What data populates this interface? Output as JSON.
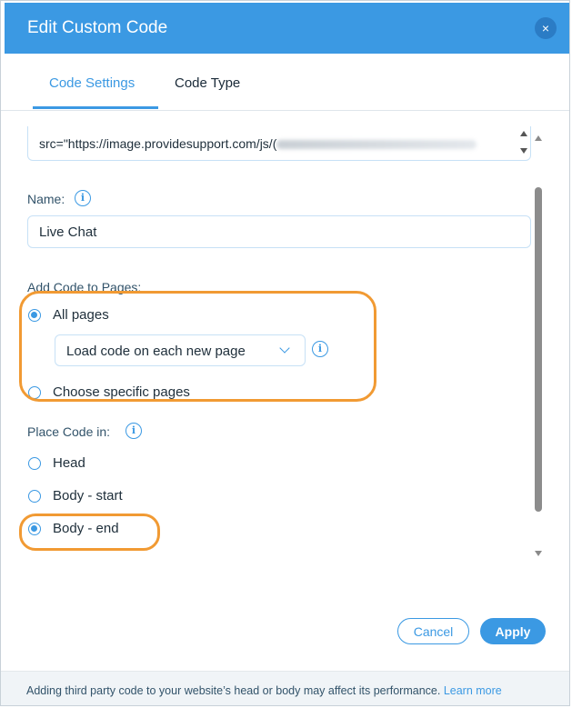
{
  "dialog": {
    "title": "Edit Custom Code",
    "close_icon": "×"
  },
  "tabs": [
    {
      "label": "Code Settings",
      "active": true
    },
    {
      "label": "Code Type",
      "active": false
    }
  ],
  "code": {
    "visible_text": "src=\"https://image.providesupport.com/js/("
  },
  "name": {
    "label": "Name:",
    "value": "Live Chat"
  },
  "add_code": {
    "label": "Add Code to Pages:",
    "options": [
      {
        "label": "All pages",
        "checked": true
      },
      {
        "label": "Choose specific pages",
        "checked": false
      }
    ],
    "dropdown_value": "Load code on each new page"
  },
  "place_code": {
    "label": "Place Code in:",
    "options": [
      {
        "label": "Head",
        "checked": false
      },
      {
        "label": "Body - start",
        "checked": false
      },
      {
        "label": "Body - end",
        "checked": true
      }
    ]
  },
  "buttons": {
    "cancel": "Cancel",
    "apply": "Apply"
  },
  "footer": {
    "text": "Adding third party code to your website’s head or body may affect its performance.",
    "link": "Learn more"
  },
  "colors": {
    "accent": "#3b99e3",
    "highlight": "#f19a33",
    "header_bg": "#3b99e3"
  }
}
